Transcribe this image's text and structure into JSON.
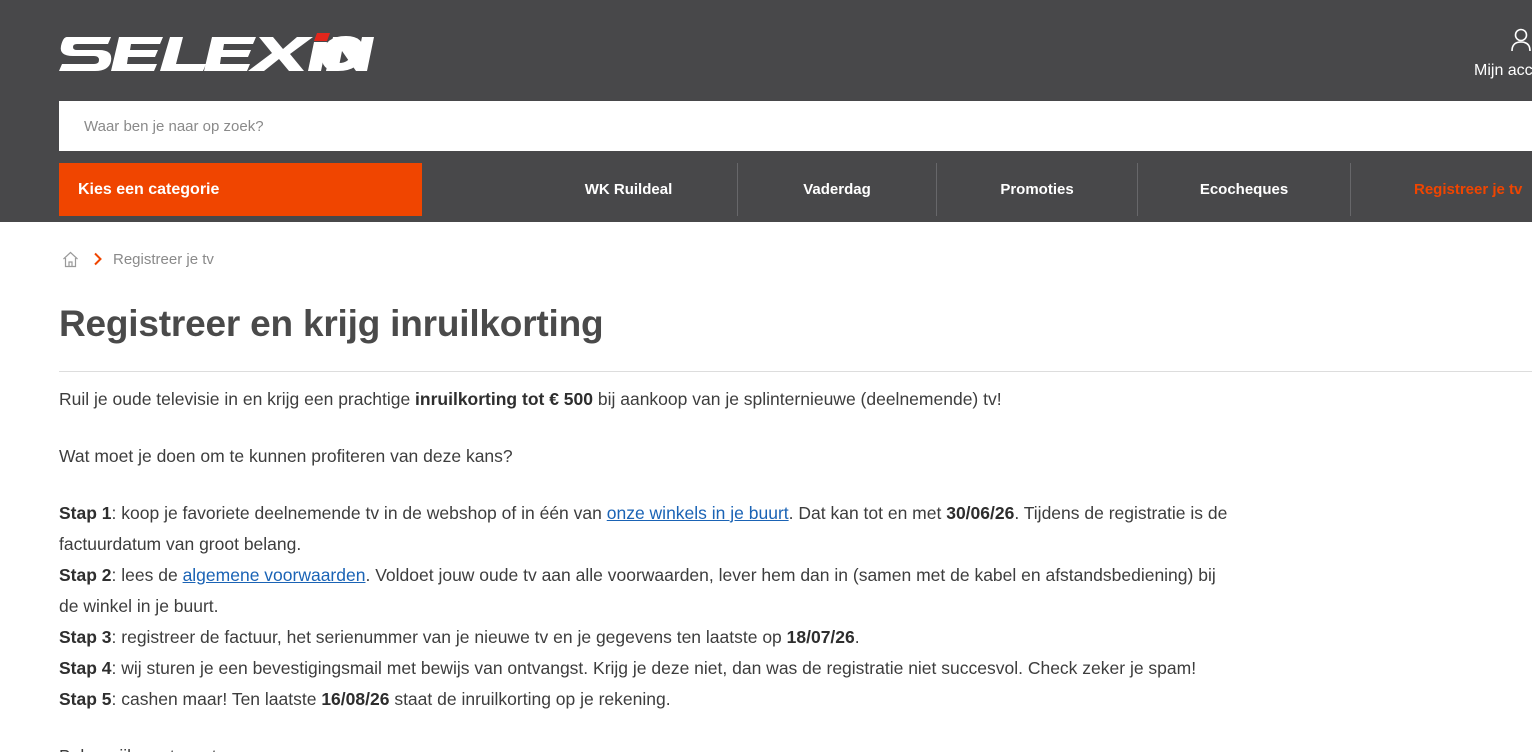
{
  "brand": {
    "name": "SELEXION",
    "accent": "#f04500",
    "header_bg": "#48484a",
    "link": "#1a63b5"
  },
  "account": {
    "icon": "user-icon",
    "label": "Mijn acc"
  },
  "search": {
    "placeholder": "Waar ben je naar op zoek?"
  },
  "category_button": "Kies een categorie",
  "nav": {
    "items": [
      {
        "label": "WK Ruildeal"
      },
      {
        "label": "Vaderdag"
      },
      {
        "label": "Promoties"
      },
      {
        "label": "Ecocheques"
      },
      {
        "label": "Registreer je tv"
      }
    ]
  },
  "breadcrumb": {
    "home_icon": "home-icon",
    "separator_icon": "chevron-right-icon",
    "current": "Registreer je tv"
  },
  "page_title": "Registreer en krijg inruilkorting",
  "intro": {
    "pre": "Ruil je oude televisie in en krijg een prachtige ",
    "bold": "inruilkorting tot € 500",
    "post": " bij aankoop van je splinternieuwe (deelnemende) tv!"
  },
  "question": "Wat moet je doen om te kunnen profiteren van deze kans?",
  "steps": [
    {
      "label": "Stap 1",
      "t1": ": koop je favoriete deelnemende tv in de webshop of in één van ",
      "link": "onze winkels in je buurt",
      "t2": ". Dat kan tot en met ",
      "date": "30/06/26",
      "t3": ". Tijdens de registratie is de factuurdatum van groot belang."
    },
    {
      "label": "Stap 2",
      "t1": ": lees de ",
      "link": "algemene voorwaarden",
      "t2": ". Voldoet jouw oude tv aan alle voorwaarden, lever hem dan in (samen met de kabel en afstandsbediening) bij de winkel in je buurt."
    },
    {
      "label": "Stap 3",
      "t1": ": registreer de factuur, het serienummer van je nieuwe tv en je gegevens ten laatste op ",
      "date": "18/07/26",
      "t2": "."
    },
    {
      "label": "Stap 4",
      "t1": ": wij sturen je een bevestigingsmail met bewijs van ontvangst. Krijg je deze niet, dan was de registratie niet succesvol. Check zeker je spam!"
    },
    {
      "label": "Stap 5",
      "t1": ": cashen maar! Ten laatste ",
      "date": "16/08/26",
      "t2": " staat de inruilkorting op je rekening."
    }
  ],
  "trailing": "Belangrijk om te weten"
}
